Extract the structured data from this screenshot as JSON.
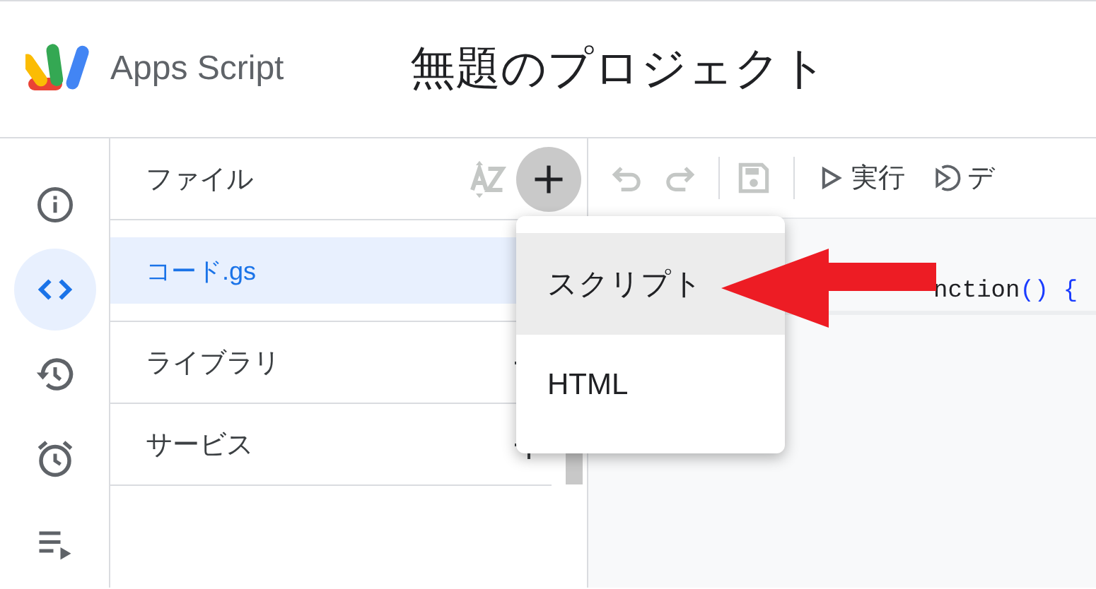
{
  "header": {
    "app_name": "Apps Script",
    "project_title": "無題のプロジェクト"
  },
  "rail": [
    {
      "kind": "info",
      "selected": false
    },
    {
      "kind": "code",
      "selected": true
    },
    {
      "kind": "history",
      "selected": false
    },
    {
      "kind": "triggers",
      "selected": false
    },
    {
      "kind": "executions",
      "selected": false
    }
  ],
  "files_panel": {
    "title": "ファイル",
    "files": [
      {
        "name": "コード.gs",
        "selected": true
      }
    ],
    "sections": [
      {
        "title": "ライブラリ"
      },
      {
        "title": "サービス"
      }
    ]
  },
  "toolbar": {
    "undo_disabled": true,
    "redo_disabled": true,
    "save_disabled": true,
    "run_label": "実行",
    "debug_label": "デ"
  },
  "code_line": [
    {
      "kind": "name",
      "text": "nction"
    },
    {
      "kind": "punct",
      "text": "() {"
    }
  ],
  "add_menu": {
    "items": [
      {
        "label": "スクリプト",
        "selected": true
      },
      {
        "label": "HTML",
        "selected": false
      }
    ]
  }
}
